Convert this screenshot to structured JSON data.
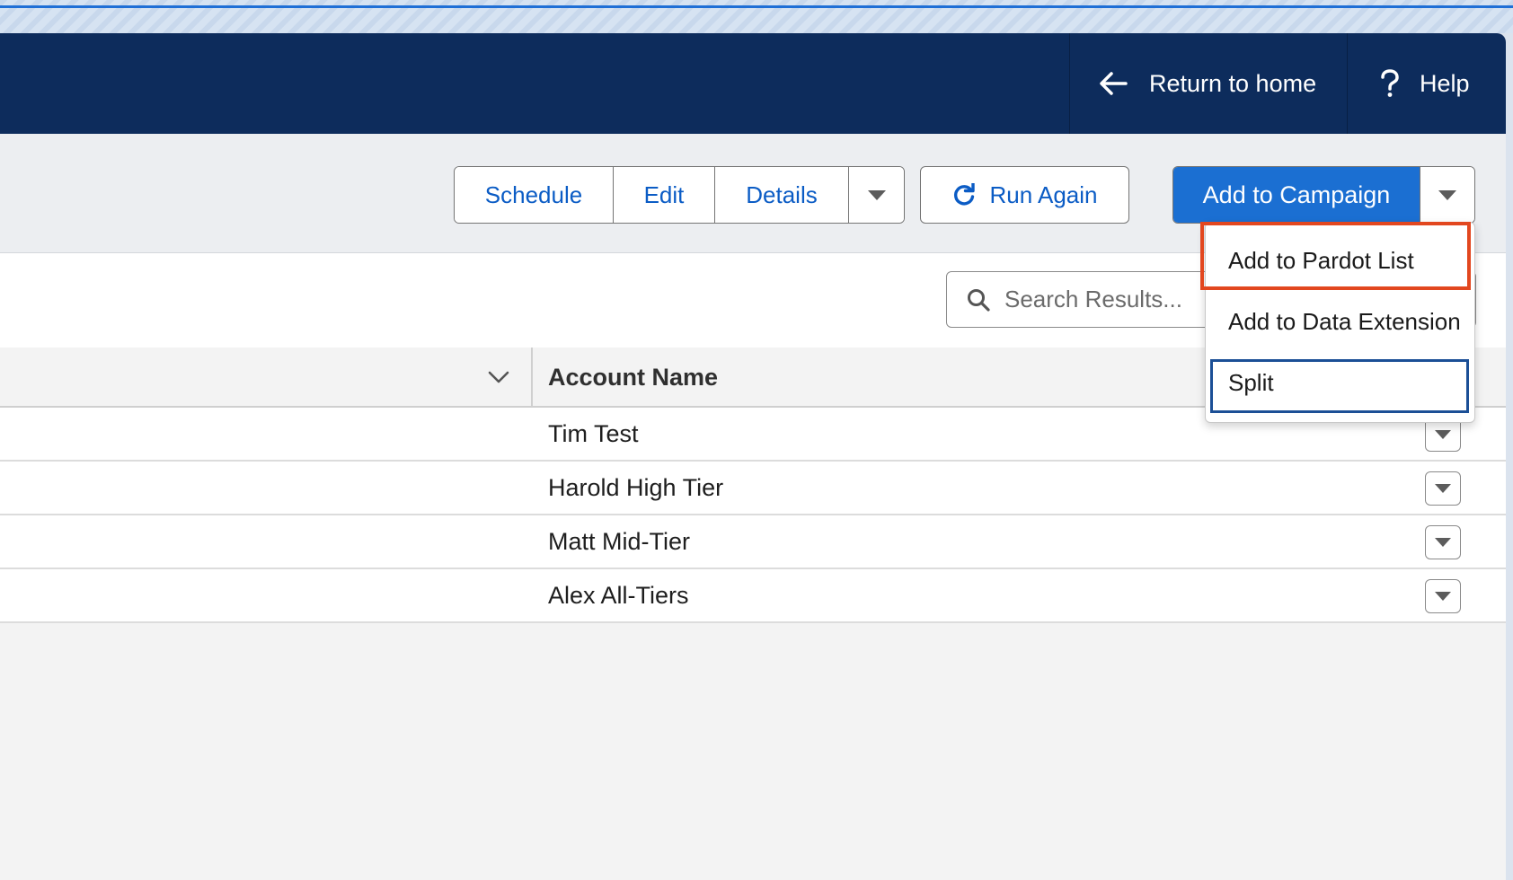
{
  "header": {
    "return_home_label": "Return to home",
    "help_label": "Help",
    "background_color": "#0d2c5c"
  },
  "toolbar": {
    "schedule_label": "Schedule",
    "edit_label": "Edit",
    "details_label": "Details",
    "run_again_label": "Run Again",
    "add_to_campaign_label": "Add to Campaign",
    "accent_color": "#1b6fd2"
  },
  "campaign_menu": {
    "items": [
      {
        "label": "Add to Pardot List"
      },
      {
        "label": "Add to Data Extension"
      },
      {
        "label": "Split"
      }
    ],
    "highlight_color": "#e2471f",
    "focus_color": "#1b4f96"
  },
  "search": {
    "placeholder": "Search Results..."
  },
  "table": {
    "column_header": "Account Name",
    "rows": [
      {
        "account_name": "Tim Test"
      },
      {
        "account_name": "Harold High Tier"
      },
      {
        "account_name": "Matt Mid-Tier"
      },
      {
        "account_name": "Alex All-Tiers"
      }
    ]
  },
  "icons": {
    "return": "arrow-left-icon",
    "help": "question-mark-icon",
    "refresh": "refresh-icon",
    "search": "search-icon",
    "caret": "caret-down-icon",
    "chevron": "chevron-down-icon"
  }
}
